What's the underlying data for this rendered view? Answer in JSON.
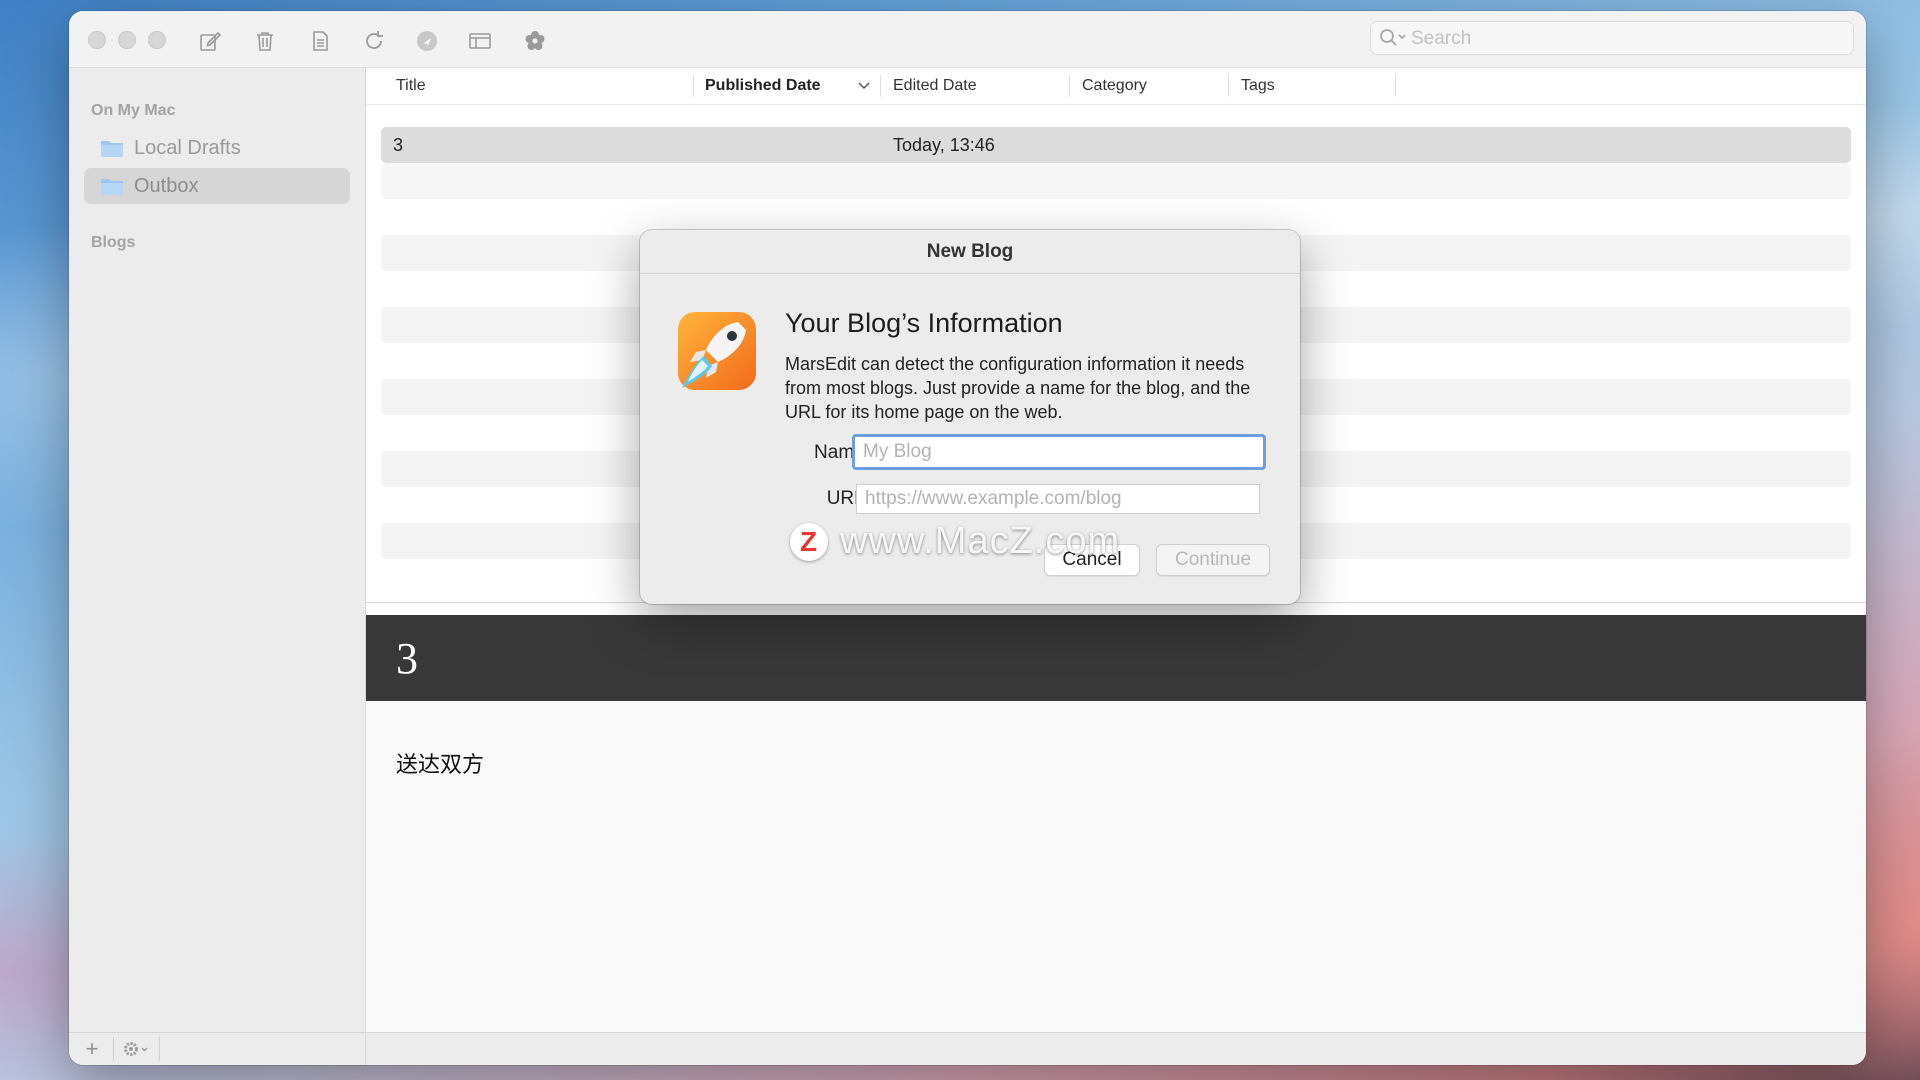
{
  "toolbar": {
    "icons": [
      "compose-icon",
      "trash-icon",
      "document-icon",
      "refresh-icon",
      "publish-icon",
      "layout-icon",
      "settings-flower-icon"
    ],
    "search_placeholder": "Search"
  },
  "sidebar": {
    "section_local": "On My Mac",
    "items": [
      {
        "label": "Local Drafts",
        "icon": "folder-icon",
        "selected": false
      },
      {
        "label": "Outbox",
        "icon": "folder-icon",
        "selected": true
      }
    ],
    "section_blogs": "Blogs",
    "bottom": {
      "add_label": "+",
      "gear_icon": "gear-icon"
    }
  },
  "list": {
    "columns": [
      "Title",
      "Published Date",
      "Edited Date",
      "Category",
      "Tags"
    ],
    "sorted_column": "Published Date",
    "rows": [
      {
        "title": "3",
        "published": "",
        "edited": "Today, 13:46",
        "category": "",
        "tags": ""
      }
    ]
  },
  "preview": {
    "title": "3",
    "body": "送达双方"
  },
  "dialog": {
    "window_title": "New Blog",
    "heading": "Your Blog’s Information",
    "description": "MarsEdit can detect the configuration information it needs from most blogs. Just provide a name for the blog, and the URL for its home page on the web.",
    "name_label": "Name:",
    "name_placeholder": "My Blog",
    "url_label": "URL:",
    "url_placeholder": "https://www.example.com/blog",
    "cancel_label": "Cancel",
    "continue_label": "Continue",
    "continue_enabled": false
  },
  "watermark": {
    "logo_letter": "Z",
    "text": "www.MacZ.com"
  },
  "colors": {
    "focus_ring": "#6f9ee0",
    "preview_header_bg": "#383838",
    "selection_bg": "#dcdcdc"
  }
}
